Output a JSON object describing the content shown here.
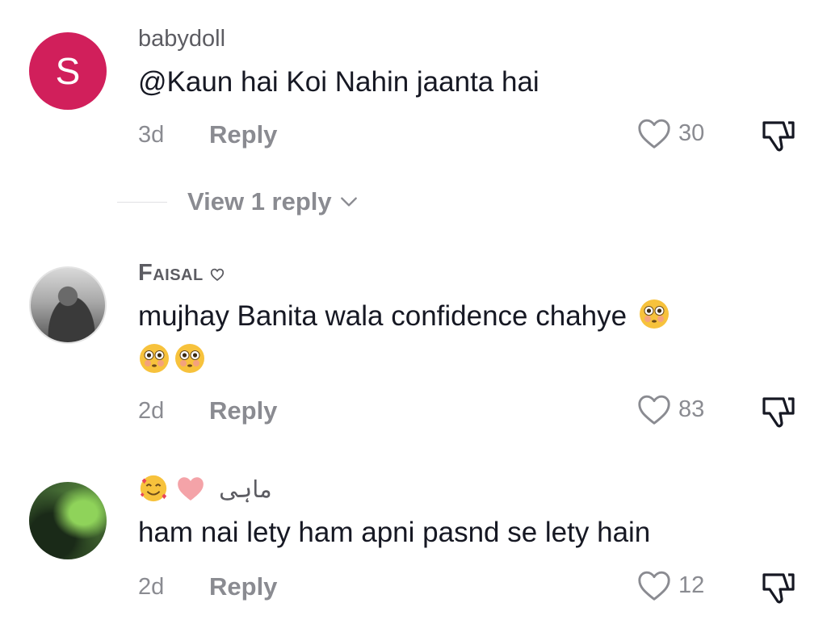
{
  "comments": [
    {
      "avatar": "S",
      "username": "babydoll",
      "text": "@Kaun hai Koi Nahin jaanta hai",
      "age": "3d",
      "reply_label": "Reply",
      "likes": "30"
    },
    {
      "username": "Faisal",
      "text": "mujhay Banita wala confidence chahye",
      "age": "2d",
      "reply_label": "Reply",
      "likes": "83"
    },
    {
      "username": "ماہی",
      "text": "ham nai lety ham apni pasnd se lety hain",
      "age": "2d",
      "reply_label": "Reply",
      "likes": "12"
    }
  ],
  "view_replies_label": "View 1 reply",
  "icons": {
    "like": "heart-outline-icon",
    "dislike": "thumbs-down-outline-icon",
    "chevron": "chevron-down-icon",
    "emoji_flushed": "flushed-face-emoji",
    "emoji_hearts": "smiling-face-with-hearts-emoji",
    "emoji_heart": "pink-heart-emoji"
  },
  "colors": {
    "avatar_letter_bg": "#d11f5b",
    "muted_text": "#8a8b91",
    "primary_text": "#161823"
  }
}
